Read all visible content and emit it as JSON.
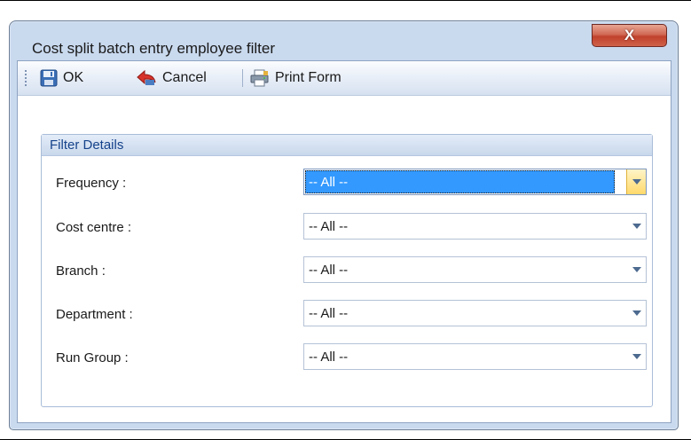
{
  "window": {
    "title": "Cost split batch entry employee filter",
    "close_glyph": "X"
  },
  "toolbar": {
    "ok_label": "OK",
    "ok_icon": "save-disk-icon",
    "cancel_label": "Cancel",
    "cancel_icon": "undo-arrow-icon",
    "print_label": "Print Form",
    "print_icon": "printer-icon"
  },
  "filter": {
    "header": "Filter Details",
    "rows": [
      {
        "label": "Frequency :",
        "value": "-- All --",
        "focused": true
      },
      {
        "label": "Cost centre :",
        "value": "-- All --",
        "focused": false
      },
      {
        "label": "Branch :",
        "value": "-- All --",
        "focused": false
      },
      {
        "label": "Department :",
        "value": "-- All --",
        "focused": false
      },
      {
        "label": "Run Group :",
        "value": "-- All --",
        "focused": false
      }
    ]
  },
  "colors": {
    "selection": "#3399ff",
    "group_header_text": "#15428b",
    "close_button": "#c0412c"
  }
}
